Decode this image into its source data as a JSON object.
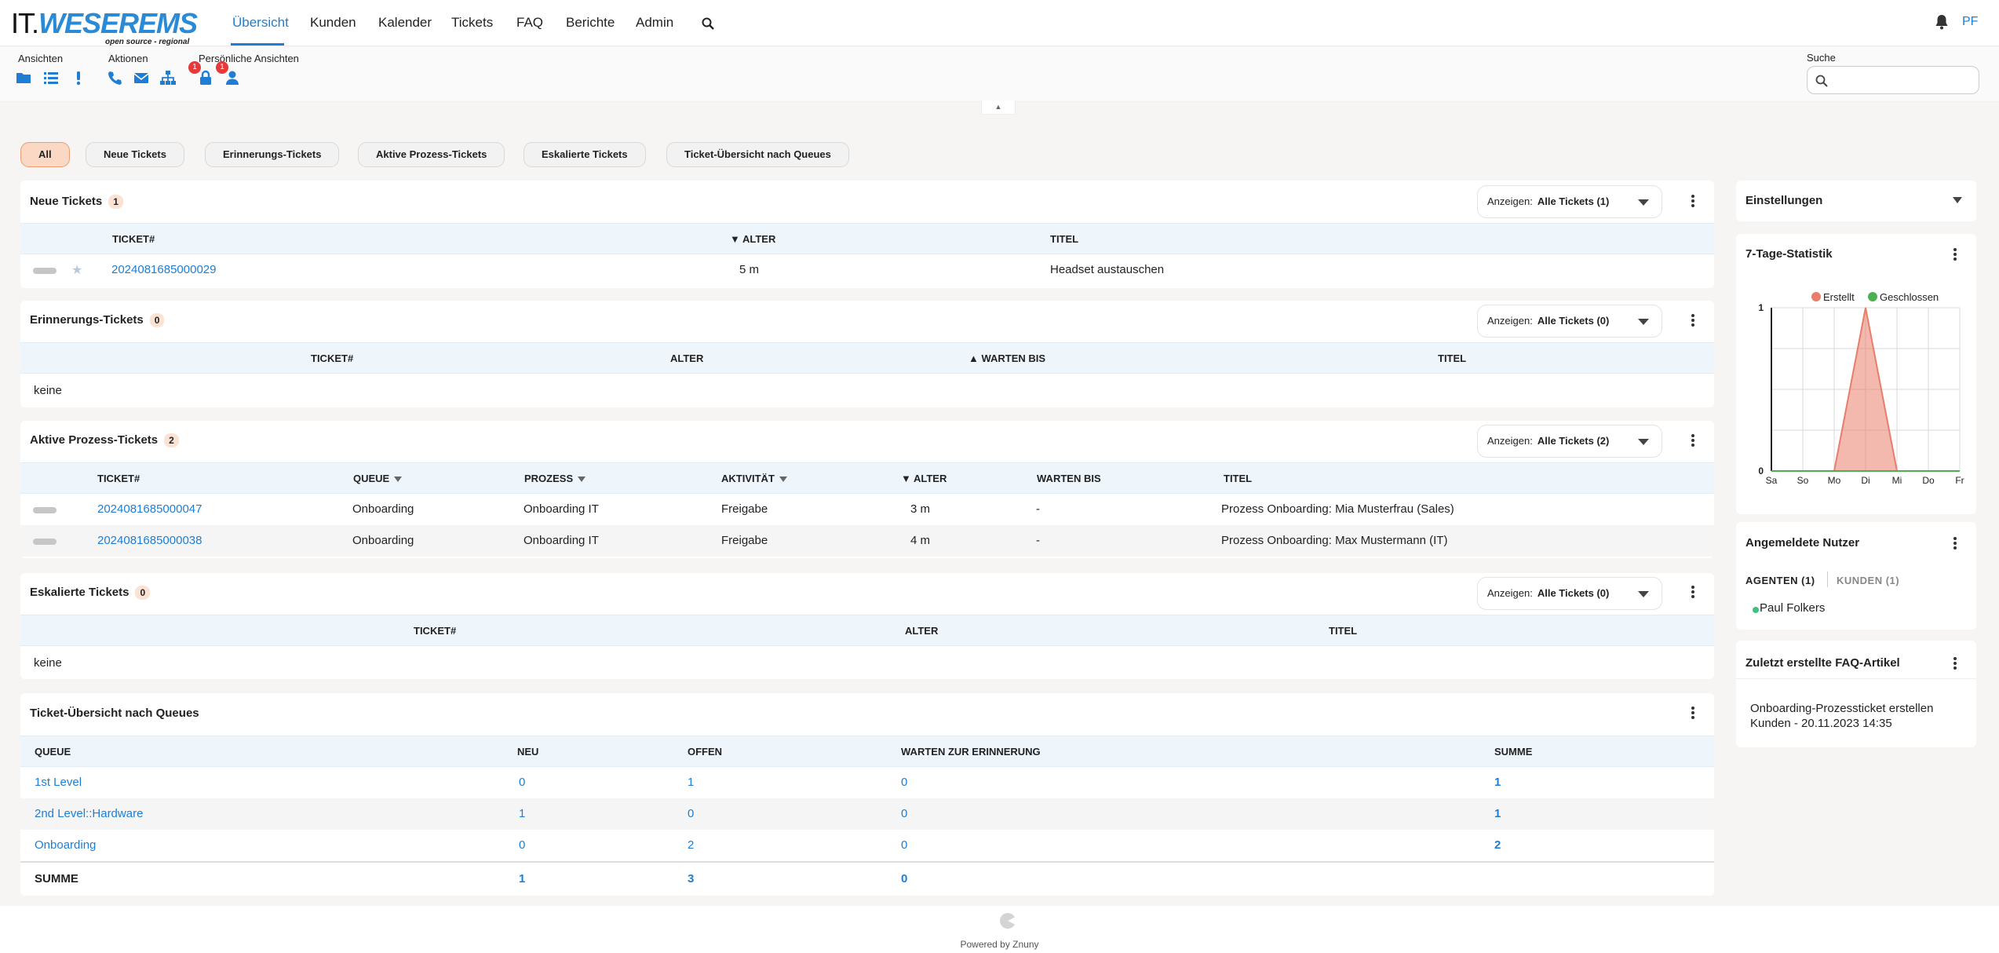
{
  "logo": {
    "it": "IT.",
    "weser": "WESER",
    "ems": "EMS",
    "tagline": "open source - regional"
  },
  "nav": {
    "items": [
      "Übersicht",
      "Kunden",
      "Kalender",
      "Tickets",
      "FAQ",
      "Berichte",
      "Admin"
    ],
    "active": "Übersicht",
    "avatar": "PF",
    "icons": {
      "search": "search-icon",
      "bell": "bell-icon"
    }
  },
  "toolbar": {
    "groups": [
      "Ansichten",
      "Aktionen",
      "Persönliche Ansichten"
    ],
    "badges": [
      "1",
      "1"
    ],
    "search_label": "Suche",
    "search_placeholder": "",
    "icons": [
      "folder-icon",
      "list-icon",
      "exclamation-icon",
      "phone-icon",
      "envelope-icon",
      "sitemap-icon",
      "lock-icon",
      "user-icon"
    ]
  },
  "filters": [
    "All",
    "Neue Tickets",
    "Erinnerungs-Tickets",
    "Aktive Prozess-Tickets",
    "Eskalierte Tickets",
    "Ticket-Übersicht nach Queues"
  ],
  "show_label": "Anzeigen:",
  "neue": {
    "title": "Neue Tickets",
    "count": "1",
    "show": "Alle Tickets (1)",
    "headers": [
      "TICKET#",
      "▼ ALTER",
      "TITEL"
    ],
    "rows": [
      {
        "ticket": "2024081685000029",
        "age": "5 m",
        "title": "Headset austauschen"
      }
    ]
  },
  "erinnerung": {
    "title": "Erinnerungs-Tickets",
    "count": "0",
    "show": "Alle Tickets (0)",
    "headers": [
      "TICKET#",
      "ALTER",
      "▲ WARTEN BIS",
      "TITEL"
    ],
    "empty": "keine"
  },
  "prozess": {
    "title": "Aktive Prozess-Tickets",
    "count": "2",
    "show": "Alle Tickets (2)",
    "headers": [
      "TICKET#",
      "QUEUE",
      "PROZESS",
      "AKTIVITÄT",
      "▼ ALTER",
      "WARTEN BIS",
      "TITEL"
    ],
    "rows": [
      {
        "ticket": "2024081685000047",
        "queue": "Onboarding",
        "process": "Onboarding IT",
        "activity": "Freigabe",
        "age": "3 m",
        "pending": "-",
        "title": "Prozess Onboarding: Mia Musterfrau (Sales)"
      },
      {
        "ticket": "2024081685000038",
        "queue": "Onboarding",
        "process": "Onboarding IT",
        "activity": "Freigabe",
        "age": "4 m",
        "pending": "-",
        "title": "Prozess Onboarding: Max Mustermann (IT)"
      }
    ]
  },
  "eskaliert": {
    "title": "Eskalierte Tickets",
    "count": "0",
    "show": "Alle Tickets (0)",
    "headers": [
      "TICKET#",
      "ALTER",
      "TITEL"
    ],
    "empty": "keine"
  },
  "queues": {
    "title": "Ticket-Übersicht nach Queues",
    "headers": [
      "QUEUE",
      "NEU",
      "OFFEN",
      "WARTEN ZUR ERINNERUNG",
      "SUMME"
    ],
    "rows": [
      {
        "queue": "1st Level",
        "neu": "0",
        "offen": "1",
        "warten": "0",
        "summe": "1"
      },
      {
        "queue": "2nd Level::Hardware",
        "neu": "1",
        "offen": "0",
        "warten": "0",
        "summe": "1"
      },
      {
        "queue": "Onboarding",
        "neu": "0",
        "offen": "2",
        "warten": "0",
        "summe": "2"
      }
    ],
    "sum": {
      "label": "SUMME",
      "neu": "1",
      "offen": "3",
      "warten": "0"
    }
  },
  "sidebar": {
    "settings": "Einstellungen",
    "stats": {
      "title": "7-Tage-Statistik"
    },
    "users": {
      "title": "Angemeldete Nutzer",
      "tab_agents": "AGENTEN (1)",
      "tab_customers": "KUNDEN (1)",
      "agent": "Paul Folkers"
    },
    "faq": {
      "title": "Zuletzt erstellte FAQ-Artikel",
      "item_line1": "Onboarding-Prozessticket erstellen",
      "item_line2": "Kunden - 20.11.2023 14:35"
    }
  },
  "chart_data": {
    "type": "area",
    "categories": [
      "Sa",
      "So",
      "Mo",
      "Di",
      "Mi",
      "Do",
      "Fr"
    ],
    "series": [
      {
        "name": "Erstellt",
        "values": [
          0,
          0,
          0,
          1,
          0,
          0,
          0
        ],
        "color": "#e97d6b"
      },
      {
        "name": "Geschlossen",
        "values": [
          0,
          0,
          0,
          0,
          0,
          0,
          0
        ],
        "color": "#4caf50"
      }
    ],
    "ylim": [
      0,
      1
    ],
    "yticks": [
      "0",
      "1"
    ],
    "grid": true,
    "legend": "top"
  },
  "footer": {
    "text": "Powered by Znuny"
  },
  "colors": {
    "accent": "#1f7ed4",
    "active_pill": "#fbd8c4",
    "badge": "#e5393a"
  }
}
